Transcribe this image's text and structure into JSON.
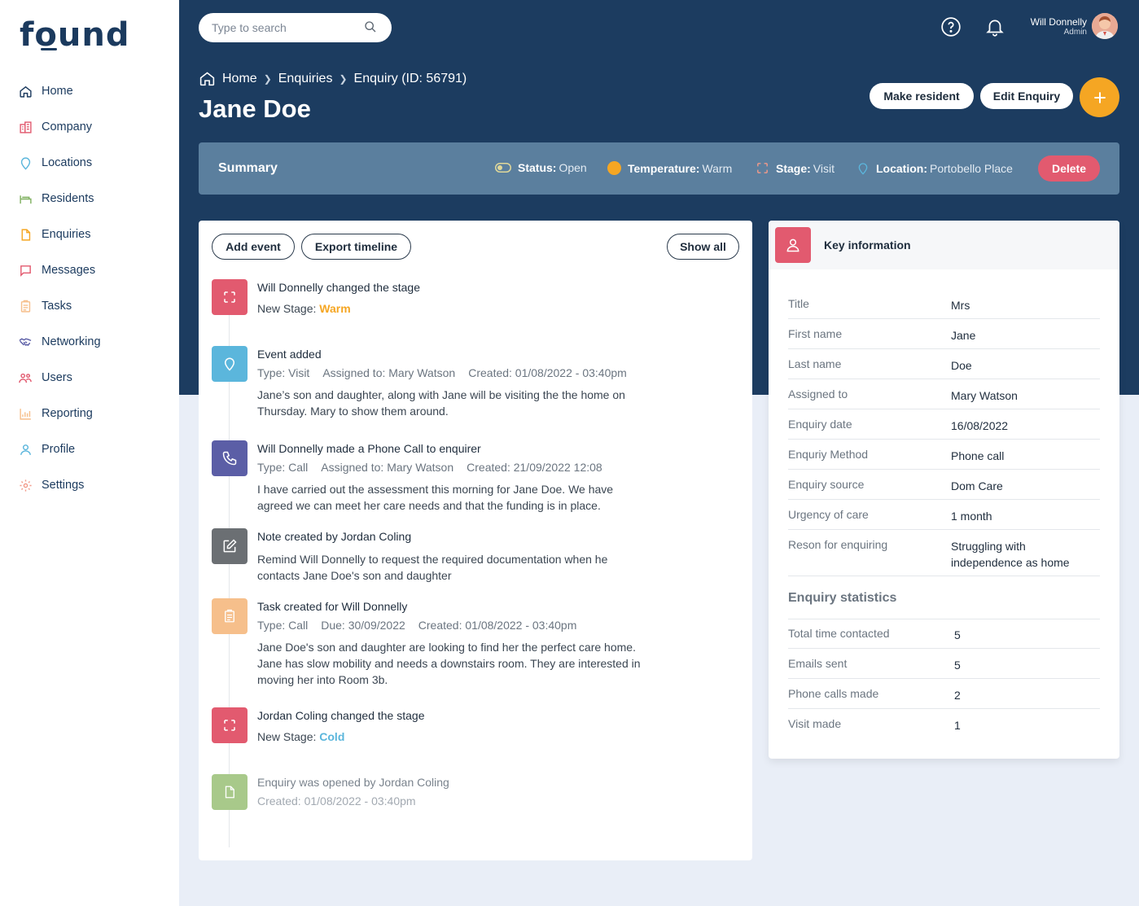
{
  "brand": {
    "logo": "found"
  },
  "nav": [
    {
      "label": "Home",
      "icon": "home-icon"
    },
    {
      "label": "Company",
      "icon": "building-icon"
    },
    {
      "label": "Locations",
      "icon": "location-pin-icon"
    },
    {
      "label": "Residents",
      "icon": "bed-icon"
    },
    {
      "label": "Enquiries",
      "icon": "document-icon"
    },
    {
      "label": "Messages",
      "icon": "message-icon"
    },
    {
      "label": "Tasks",
      "icon": "clipboard-icon"
    },
    {
      "label": "Networking",
      "icon": "handshake-icon"
    },
    {
      "label": "Users",
      "icon": "users-icon"
    },
    {
      "label": "Reporting",
      "icon": "bar-chart-icon"
    },
    {
      "label": "Profile",
      "icon": "person-icon"
    },
    {
      "label": "Settings",
      "icon": "gear-icon"
    }
  ],
  "search": {
    "placeholder": "Type to search"
  },
  "user": {
    "name": "Will Donnelly",
    "role": "Admin"
  },
  "breadcrumb": {
    "home": "Home",
    "enquiries": "Enquiries",
    "current": "Enquiry (ID: 56791)"
  },
  "page": {
    "title": "Jane Doe"
  },
  "actions": {
    "make_resident": "Make resident",
    "edit_enquiry": "Edit Enquiry"
  },
  "summary": {
    "title": "Summary",
    "status_label": "Status:",
    "status_value": "Open",
    "temperature_label": "Temperature:",
    "temperature_value": "Warm",
    "stage_label": "Stage:",
    "stage_value": "Visit",
    "location_label": "Location:",
    "location_value": "Portobello Place",
    "delete_label": "Delete",
    "colors": {
      "temperature_dot": "#f5a623",
      "delete": "#e25a6f"
    }
  },
  "timeline": {
    "add_event": "Add event",
    "export_timeline": "Export timeline",
    "show_all": "Show all",
    "events": [
      {
        "title": "Will Donnelly changed the stage",
        "stage_prefix": "New Stage:",
        "stage": "Warm",
        "icon": "refresh-icon",
        "color": "#e25a6f"
      },
      {
        "title": "Event added",
        "meta1": "Type: Visit",
        "meta2": "Assigned to: Mary Watson",
        "meta3": "Created: 01/08/2022  -  03:40pm",
        "text": "Jane’s son and daughter, along with Jane will be visiting the the home on Thursday. Mary to show them around.",
        "icon": "location-pin-icon",
        "color": "#5bb6dc"
      },
      {
        "title": "Will Donnelly made a Phone Call to enquirer",
        "meta1": "Type: Call",
        "meta2": "Assigned to: Mary Watson",
        "meta3": "Created: 21/09/2022 12:08",
        "text": "I have carried out the assessment this morning for Jane Doe. We have agreed we can meet her care needs and that the funding is in place.",
        "icon": "phone-icon",
        "color": "#5b5ea6"
      },
      {
        "title": "Note created by Jordan Coling",
        "text": "Remind Will Donnelly to request the required documentation when he contacts Jane Doe's son and daughter",
        "icon": "edit-icon",
        "color": "#6b6f73"
      },
      {
        "title": "Task created for Will Donnelly",
        "meta1": "Type: Call",
        "meta2": "Due: 30/09/2022",
        "meta3": "Created: 01/08/2022  -  03:40pm",
        "text": "Jane Doe's son and daughter are looking to find her the perfect care home. Jane has slow mobility and needs a downstairs room. They are interested in moving her into Room 3b.",
        "icon": "clipboard-icon",
        "color": "#f6bf8b"
      },
      {
        "title": "Jordan Coling changed the stage",
        "stage_prefix": "New Stage:",
        "stage": "Cold",
        "icon": "refresh-icon",
        "color": "#e25a6f"
      },
      {
        "title": "Enquiry was opened by Jordan Coling",
        "meta1": "Created: 01/08/2022  -  03:40pm",
        "icon": "document-icon",
        "color": "#a8c98a"
      }
    ]
  },
  "key_info": {
    "title": "Key information",
    "rows": [
      {
        "label": "Title",
        "value": "Mrs"
      },
      {
        "label": "First name",
        "value": "Jane"
      },
      {
        "label": "Last name",
        "value": "Doe"
      },
      {
        "label": "Assigned to",
        "value": "Mary Watson"
      },
      {
        "label": "Enquiry date",
        "value": "16/08/2022"
      },
      {
        "label": "Enquriy Method",
        "value": "Phone call"
      },
      {
        "label": "Enquiry source",
        "value": "Dom Care"
      },
      {
        "label": "Urgency of care",
        "value": "1 month"
      },
      {
        "label": "Reson for enquiring",
        "value": "Struggling with independence as home"
      }
    ],
    "stats_title": "Enquiry statistics",
    "stats": [
      {
        "label": "Total time contacted",
        "value": "5"
      },
      {
        "label": "Emails sent",
        "value": "5"
      },
      {
        "label": "Phone calls made",
        "value": "2"
      },
      {
        "label": "Visit made",
        "value": "1"
      }
    ]
  }
}
